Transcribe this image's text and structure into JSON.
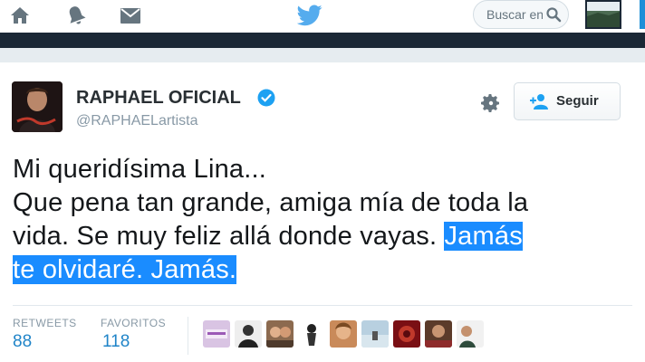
{
  "nav": {
    "icons": [
      "home-icon",
      "notifications-icon",
      "messages-icon",
      "twitter-bird-icon"
    ],
    "search_placeholder": "Buscar en",
    "colors": {
      "brand": "#1da1f2",
      "dark": "#1b2836"
    }
  },
  "tweet": {
    "display_name": "RAPHAEL OFICIAL",
    "handle": "@RAPHAELartista",
    "follow_label": "Seguir",
    "text_lines": [
      {
        "plain": "Mi queridísima Lina...",
        "highlight": ""
      },
      {
        "plain": "Que pena tan grande, amiga mía de toda la",
        "highlight": ""
      },
      {
        "plain": "vida. Se muy feliz allá donde vayas. ",
        "highlight": "Jamás"
      },
      {
        "plain": "",
        "highlight": "te olvidaré. Jamás."
      }
    ],
    "stats": {
      "retweets_label": "RETWEETS",
      "retweets_value": "88",
      "favorites_label": "FAVORITOS",
      "favorites_value": "118"
    },
    "favoriters_count_shown": 9,
    "colors": {
      "link": "#1f84c8",
      "selection": "#1a8cff",
      "verified": "#1da1f2"
    }
  }
}
